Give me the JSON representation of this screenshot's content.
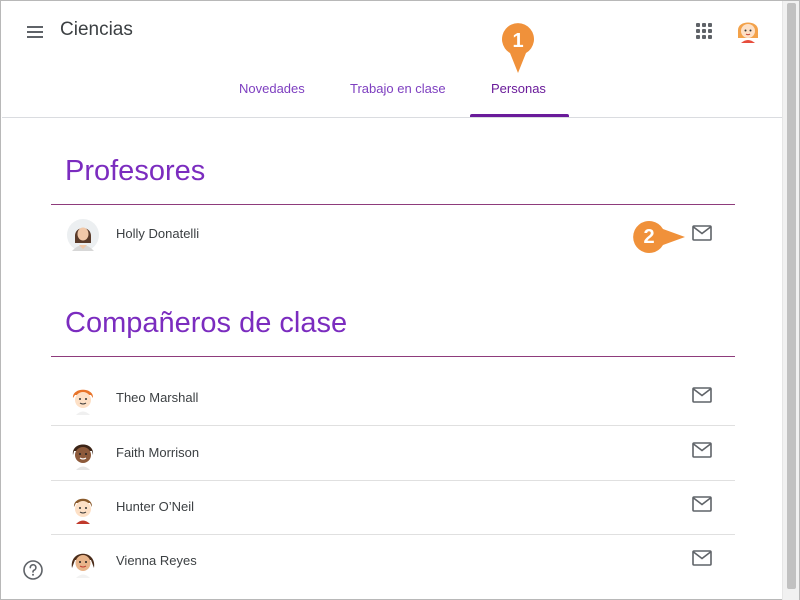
{
  "header": {
    "title": "Ciencias",
    "menu_icon": "hamburger-menu-icon",
    "apps_icon": "apps-grid-icon"
  },
  "tabs": [
    {
      "label": "Novedades",
      "active": false
    },
    {
      "label": "Trabajo en clase",
      "active": false
    },
    {
      "label": "Personas",
      "active": true
    }
  ],
  "callouts": [
    "1",
    "2"
  ],
  "teachers": {
    "title": "Profesores",
    "people": [
      {
        "name": "Holly Donatelli",
        "icon": "mail-icon"
      }
    ]
  },
  "classmates": {
    "title": "Compañeros de clase",
    "people": [
      {
        "name": "Theo Marshall",
        "icon": "mail-icon"
      },
      {
        "name": "Faith Morrison",
        "icon": "mail-icon"
      },
      {
        "name": "Hunter O’Neil",
        "icon": "mail-icon"
      },
      {
        "name": "Vienna Reyes",
        "icon": "mail-icon"
      }
    ]
  },
  "colors": {
    "accent": "#6a1b9a",
    "section_title": "#7b2cbf",
    "callout": "#f0913a"
  },
  "help_icon": "help-circle-icon"
}
